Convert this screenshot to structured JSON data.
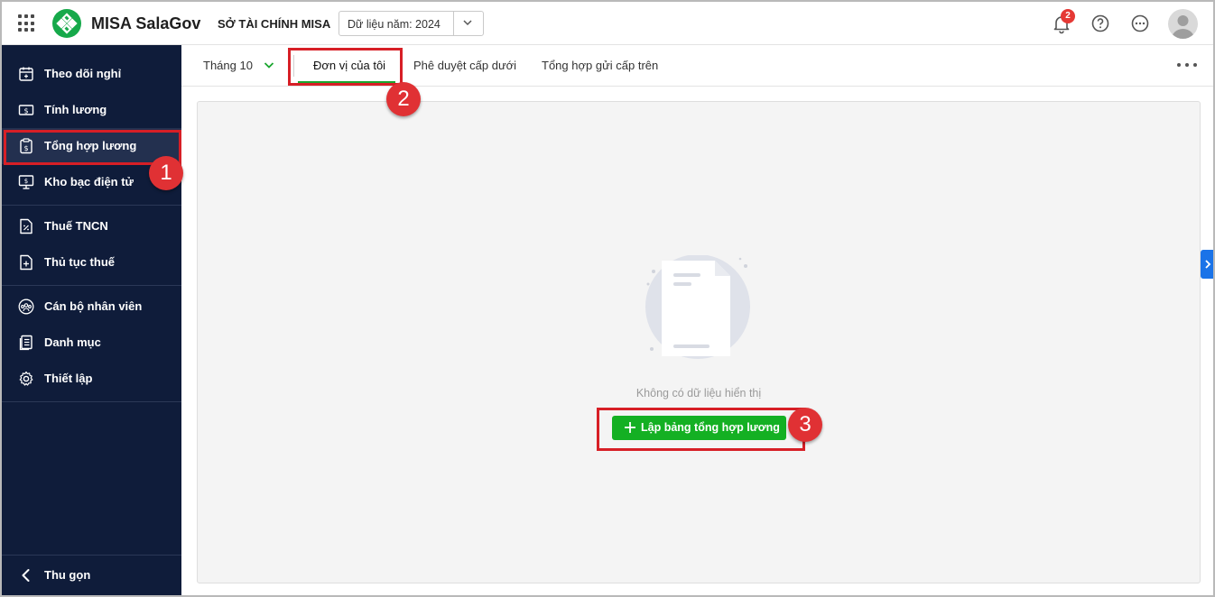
{
  "header": {
    "app_name": "MISA SalaGov",
    "org_name": "SỞ TÀI CHÍNH MISA",
    "year_select_value": "Dữ liệu năm: 2024",
    "notification_count": "2"
  },
  "sidebar": {
    "items": [
      {
        "label": "Theo dõi nghỉ",
        "icon": "calendar-icon"
      },
      {
        "label": "Tính lương",
        "icon": "money-icon"
      },
      {
        "label": "Tổng hợp lương",
        "icon": "clipboard-dollar-icon"
      },
      {
        "label": "Kho bạc điện tử",
        "icon": "monitor-dollar-icon"
      },
      {
        "label": "Thuế TNCN",
        "icon": "tax-document-icon"
      },
      {
        "label": "Thủ tục thuế",
        "icon": "document-plus-icon"
      },
      {
        "label": "Cán bộ nhân viên",
        "icon": "team-icon"
      },
      {
        "label": "Danh mục",
        "icon": "list-document-icon"
      },
      {
        "label": "Thiết lập",
        "icon": "gear-icon"
      }
    ],
    "collapse_label": "Thu gọn"
  },
  "tabs": {
    "month": "Tháng 10",
    "items": [
      {
        "label": "Đơn vị của tôi"
      },
      {
        "label": "Phê duyệt cấp dưới"
      },
      {
        "label": "Tổng hợp gửi cấp trên"
      }
    ]
  },
  "content": {
    "empty_text": "Không có dữ liệu hiển thị",
    "create_button_label": "Lập bảng tổng hợp lương"
  },
  "annotations": {
    "steps": [
      "1",
      "2",
      "3"
    ]
  },
  "colors": {
    "sidebar_bg": "#0f1c3a",
    "accent_green": "#14b023",
    "highlight_red": "#d71f26"
  }
}
